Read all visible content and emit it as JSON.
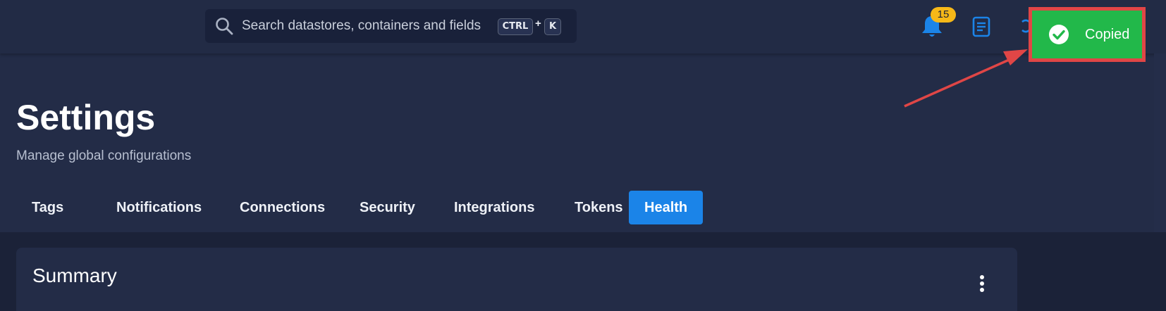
{
  "search": {
    "placeholder": "Search datastores, containers and fields",
    "shortcut_key1": "CTRL",
    "shortcut_plus": "+",
    "shortcut_key2": "K"
  },
  "header": {
    "notification_count": "15"
  },
  "toast": {
    "message": "Copied"
  },
  "page": {
    "title": "Settings",
    "subtitle": "Manage global configurations"
  },
  "tabs": [
    {
      "label": "Tags",
      "active": false
    },
    {
      "label": "Notifications",
      "active": false
    },
    {
      "label": "Connections",
      "active": false
    },
    {
      "label": "Security",
      "active": false
    },
    {
      "label": "Integrations",
      "active": false
    },
    {
      "label": "Tokens",
      "active": false
    },
    {
      "label": "Health",
      "active": true
    }
  ],
  "summary": {
    "title": "Summary"
  },
  "colors": {
    "background": "#232c47",
    "accent": "#1b84e8",
    "toast": "#22b84a",
    "highlight": "#e04646",
    "badge": "#f6b818"
  },
  "icons": [
    "search-icon",
    "bell-icon",
    "document-icon",
    "check-circle-icon",
    "kebab-menu-icon"
  ]
}
